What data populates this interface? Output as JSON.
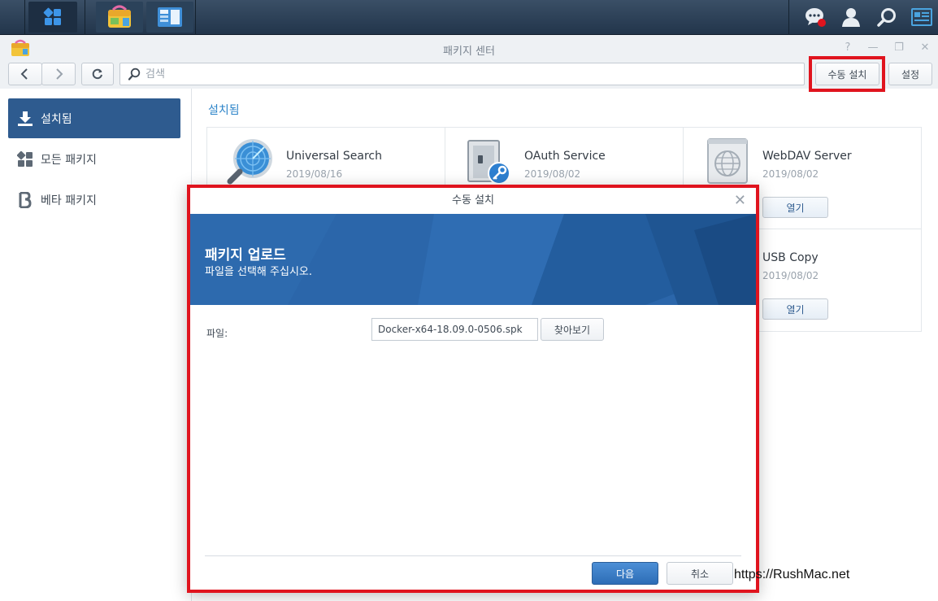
{
  "taskbar": {
    "icons": [
      "main-menu-icon",
      "package-center-icon",
      "control-panel-icon"
    ],
    "right_icons": [
      "notification-chat-icon",
      "user-icon",
      "search-icon",
      "widgets-icon"
    ]
  },
  "window": {
    "title": "패키지 센터",
    "controls": [
      "?",
      "—",
      "❐",
      "✕"
    ]
  },
  "toolbar": {
    "search_placeholder": "검색",
    "manual_install_label": "수동 설치",
    "settings_label": "설정"
  },
  "sidebar": {
    "items": [
      {
        "label": "설치됨",
        "icon": "download-icon",
        "active": true
      },
      {
        "label": "모든 패키지",
        "icon": "grid-icon",
        "active": false
      },
      {
        "label": "베타 패키지",
        "icon": "beta-icon",
        "active": false
      }
    ]
  },
  "main": {
    "section_title": "설치됨",
    "packages": [
      {
        "name": "Universal Search",
        "date": "2019/08/16",
        "button": ""
      },
      {
        "name": "OAuth Service",
        "date": "2019/08/02",
        "button": ""
      },
      {
        "name": "WebDAV Server",
        "date": "2019/08/02",
        "button": "열기"
      },
      {
        "name": "USB Copy",
        "date": "2019/08/02",
        "button": "열기"
      }
    ]
  },
  "dialog": {
    "title": "수동 설치",
    "banner_title": "패키지 업로드",
    "banner_subtitle": "파일을 선택해 주십시오.",
    "file_label": "파일:",
    "file_value": "Docker-x64-18.09.0-0506.spk",
    "browse_label": "찾아보기",
    "next_label": "다음",
    "cancel_label": "취소"
  },
  "watermark": "https://RushMac.net",
  "colors": {
    "accent": "#2e5b8f",
    "link": "#2d84c9",
    "highlight": "#e0141e",
    "banner": "#2b66aa"
  }
}
